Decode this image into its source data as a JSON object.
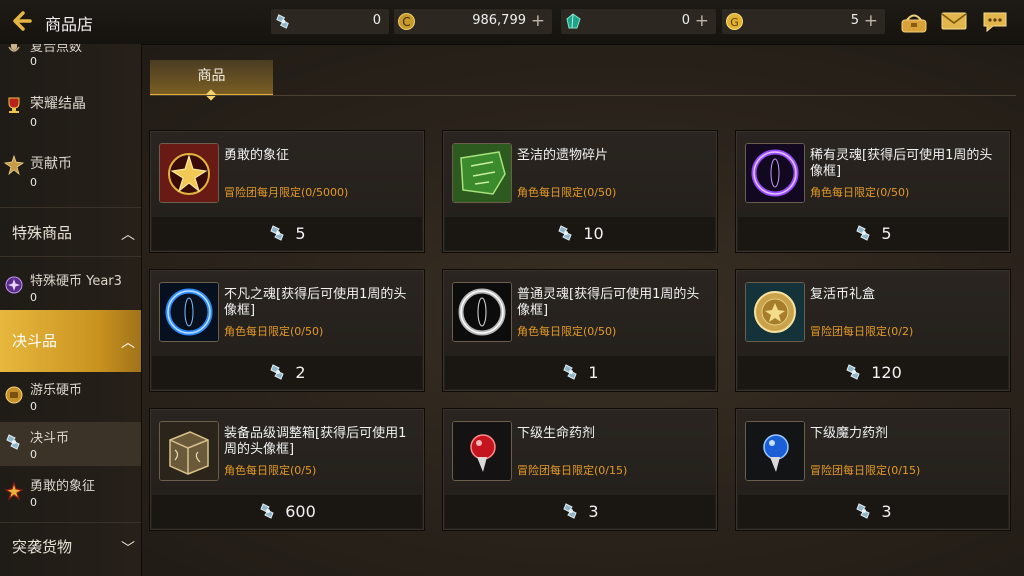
{
  "header": {
    "title": "商品店",
    "currencies": [
      {
        "icon": "duel-coin-icon",
        "value": "0"
      },
      {
        "icon": "gold-c-coin-icon",
        "value": "986,799"
      },
      {
        "icon": "green-gem-icon",
        "value": "0"
      },
      {
        "icon": "gold-g-coin-icon",
        "value": "5"
      }
    ],
    "right_icons": [
      "shop-cart-icon",
      "mail-icon",
      "chat-icon"
    ]
  },
  "sidebar": {
    "currencies_top": [
      {
        "name": "复合点数",
        "count": "0",
        "icon": "mic-icon"
      },
      {
        "name": "荣耀结晶",
        "count": "0",
        "icon": "trophy-icon"
      },
      {
        "name": "贡献币",
        "count": "0",
        "icon": "medal-icon"
      }
    ],
    "special_header": "特殊商品",
    "special_items": [
      {
        "name": "特殊硬币 Year3",
        "count": "0",
        "icon": "purple-coin-icon"
      }
    ],
    "duel_header": "决斗品",
    "duel_items": [
      {
        "name": "游乐硬币",
        "count": "0",
        "icon": "play-coin-icon"
      },
      {
        "name": "决斗币",
        "count": "0",
        "icon": "duel-coin-icon"
      },
      {
        "name": "勇敢的象征",
        "count": "0",
        "icon": "brave-symbol-icon"
      }
    ],
    "raid_header": "突袭货物"
  },
  "tabs": [
    {
      "label": "商品",
      "active": true
    }
  ],
  "items": [
    {
      "name": "勇敢的象征",
      "limit": "冒险团每月限定(0/5000)",
      "price": "5",
      "icon": "brave-symbol-icon"
    },
    {
      "name": "圣洁的遗物碎片",
      "limit": "角色每日限定(0/50)",
      "price": "10",
      "icon": "relic-fragment-icon"
    },
    {
      "name": "稀有灵魂[获得后可使用1周的头像框]",
      "limit": "角色每日限定(0/50)",
      "price": "5",
      "icon": "purple-soul-icon"
    },
    {
      "name": "不凡之魂[获得后可使用1周的头像框]",
      "limit": "角色每日限定(0/50)",
      "price": "2",
      "icon": "blue-soul-icon"
    },
    {
      "name": "普通灵魂[获得后可使用1周的头像框]",
      "limit": "角色每日限定(0/50)",
      "price": "1",
      "icon": "white-soul-icon"
    },
    {
      "name": "复活币礼盒",
      "limit": "冒险团每日限定(0/2)",
      "price": "120",
      "icon": "revive-coin-icon"
    },
    {
      "name": "装备品级调整箱[获得后可使用1周的头像框]",
      "limit": "角色每日限定(0/5)",
      "price": "600",
      "icon": "equip-box-icon"
    },
    {
      "name": "下级生命药剂",
      "limit": "冒险团每日限定(0/15)",
      "price": "3",
      "icon": "red-potion-icon"
    },
    {
      "name": "下级魔力药剂",
      "limit": "冒险团每日限定(0/15)",
      "price": "3",
      "icon": "blue-potion-icon"
    }
  ],
  "colors": {
    "accent": "#e7b83d",
    "limit_text": "#e29a2a",
    "panel": "#2a2520"
  }
}
